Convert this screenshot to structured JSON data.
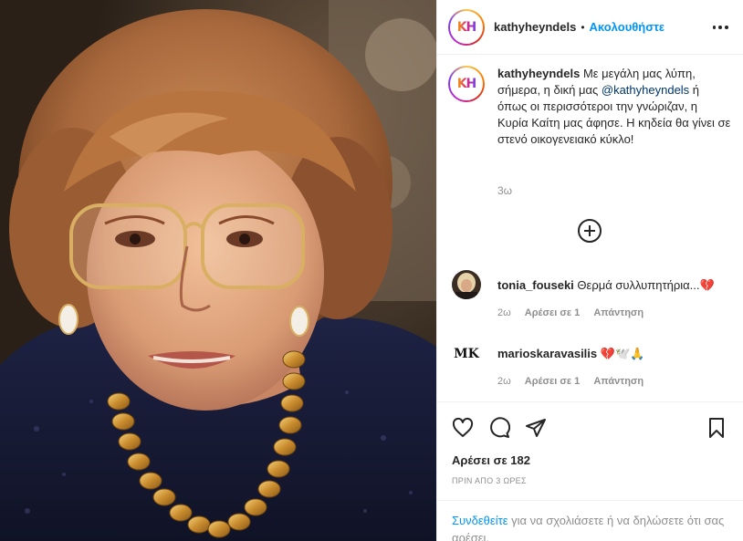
{
  "post": {
    "photo_alt": "Πορτρέτο γυναίκας με γυαλιά και χρυσό κολιέ"
  },
  "header": {
    "username": "kathyheyndels",
    "separator": "•",
    "follow_label": "Ακολουθήστε",
    "avatar_logo": "KH"
  },
  "caption": {
    "username": "kathyheyndels",
    "text_part1": " Με μεγάλη μας λύπη, σήμερα, η δική μας ",
    "mention": "@kathyheyndels",
    "text_part2": " ή όπως οι περισσότεροι την γνώριζαν, η Κυρία Καίτη μας άφησε. Η κηδεία θα γίνει σε στενό οικογενειακό κύκλο!",
    "time": "3ω"
  },
  "comments": [
    {
      "username": "tonia_fouseki",
      "text": "Θερμά συλλυπητήρια...",
      "emoji": "💔",
      "time": "2ω",
      "likes": "Αρέσει σε 1",
      "reply": "Απάντηση"
    },
    {
      "username": "marioskaravasilis",
      "text": "",
      "emoji": "💔🕊️🙏",
      "time": "2ω",
      "likes": "Αρέσει σε 1",
      "reply": "Απάντηση",
      "avatar_logo": "MK"
    }
  ],
  "actions": {
    "likes_label": "Αρέσει σε 182",
    "posted_time": "ΠΡΙΝ ΑΠΟ 3 ΩΡΕΣ"
  },
  "login": {
    "link": "Συνδεθείτε",
    "text": " για να σχολιάσετε ή να δηλώσετε ότι σας αρέσει."
  },
  "colors": {
    "accent": "#0095f6",
    "mention": "#00376b",
    "muted": "#8e8e8e",
    "heart": "#ed4956"
  }
}
